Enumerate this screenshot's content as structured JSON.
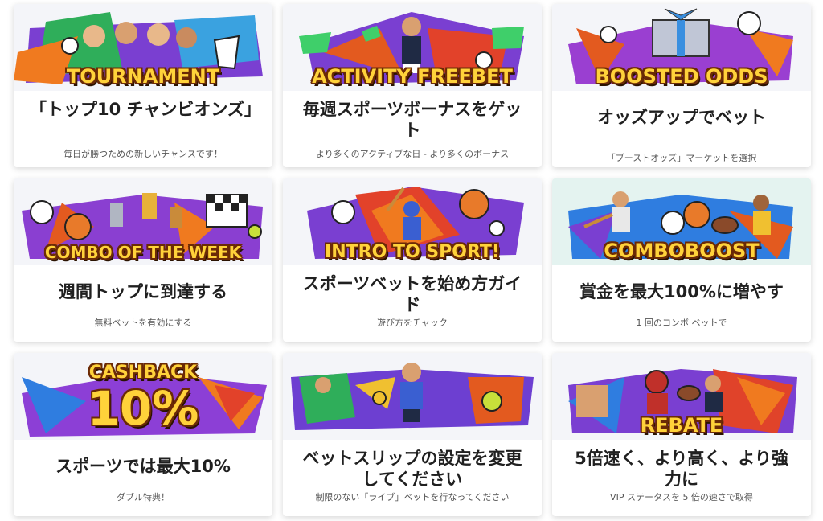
{
  "cards": [
    {
      "banner_text": "TOURNAMENT",
      "title": "「トップ10 チャンビオンズ」",
      "subtitle": "毎日が勝つための新しいチャンスです！",
      "accent": "#7a3fd1"
    },
    {
      "banner_text": "ACTIVITY FREEBET",
      "title": "毎週スポーツボーナスをゲット",
      "subtitle": "より多くのアクティブな日 - より多くのボーナス",
      "accent": "#e35a1f"
    },
    {
      "banner_text": "BOOSTED ODDS",
      "title": "オッズアップでベット",
      "subtitle": "「ブーストオッズ」マーケットを選択",
      "accent": "#b23ad1"
    },
    {
      "banner_text": "COMBO OF THE WEEK",
      "title": "週間トップに到達する",
      "subtitle": "無料ベットを有効にする",
      "accent": "#8a3fd1"
    },
    {
      "banner_text": "INTRO TO SPORT!",
      "title": "スポーツベットを始め方ガイド",
      "subtitle": "遊び方をチャック",
      "accent": "#e2422a"
    },
    {
      "banner_text": "COMBOBOOST",
      "title": "賞金を最大100%に増やす",
      "subtitle": "1 回のコンボ ベットで",
      "accent": "#2f7de0"
    },
    {
      "banner_text": "CASHBACK",
      "banner_text_2": "10%",
      "title": "スポーツでは最大10%",
      "subtitle": "ダブル特典！",
      "accent": "#8c3fd6"
    },
    {
      "banner_text": "",
      "title": "ベットスリップの設定を変更してください",
      "subtitle": "制限のない「ライブ」ベットを行なってください",
      "accent": "#6d3fd1"
    },
    {
      "banner_text": "REBATE",
      "title": "5倍速く、より高く、より強力に",
      "subtitle": "VIP ステータスを 5 倍の速さで取得",
      "accent": "#e0432a"
    }
  ]
}
